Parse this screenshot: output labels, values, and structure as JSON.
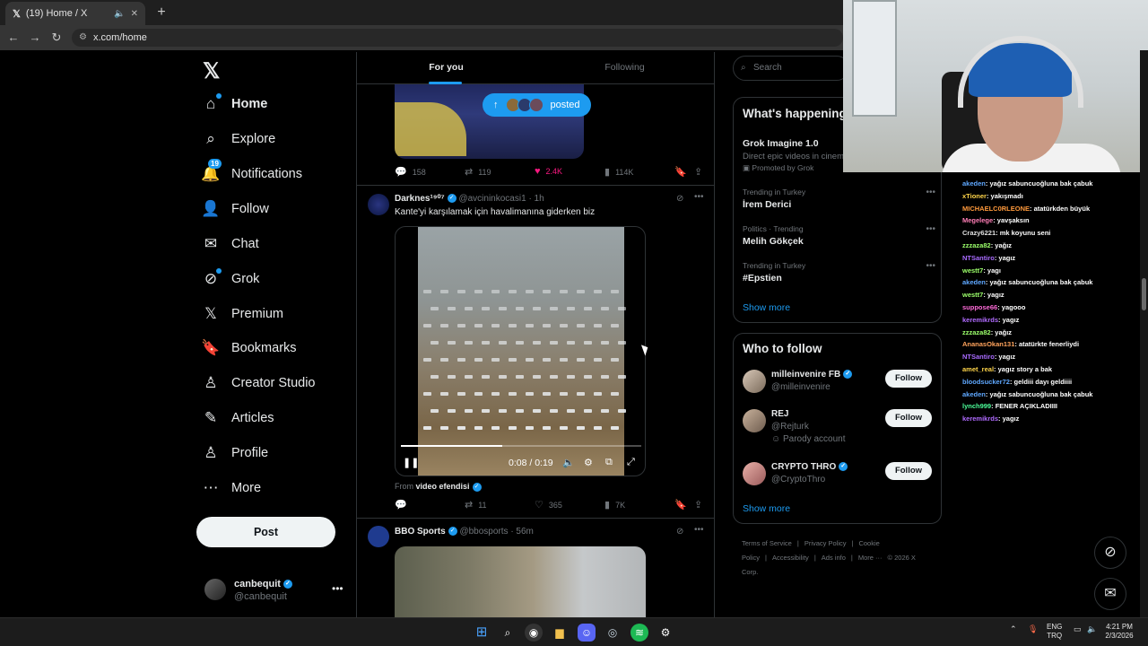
{
  "browser": {
    "tab_title": "(19) Home / X",
    "url": "x.com/home"
  },
  "nav": {
    "items": [
      {
        "label": "Home",
        "icon": "home-icon"
      },
      {
        "label": "Explore",
        "icon": "search-icon"
      },
      {
        "label": "Notifications",
        "icon": "bell-icon",
        "badge": "19"
      },
      {
        "label": "Follow",
        "icon": "person-plus-icon"
      },
      {
        "label": "Chat",
        "icon": "mail-icon"
      },
      {
        "label": "Grok",
        "icon": "grok-icon"
      },
      {
        "label": "Premium",
        "icon": "x-icon"
      },
      {
        "label": "Bookmarks",
        "icon": "bookmark-icon"
      },
      {
        "label": "Creator Studio",
        "icon": "creator-icon"
      },
      {
        "label": "Articles",
        "icon": "article-icon"
      },
      {
        "label": "Profile",
        "icon": "person-icon"
      },
      {
        "label": "More",
        "icon": "more-circle-icon"
      }
    ],
    "post_label": "Post",
    "account": {
      "name": "canbequit",
      "handle": "@canbequit"
    }
  },
  "feed": {
    "tabs": [
      "For you",
      "Following"
    ],
    "posted_label": "posted",
    "top_post": {
      "replies": "158",
      "reposts": "119",
      "likes": "2.4K",
      "views": "114K"
    },
    "darkness_post": {
      "name": "Darknes¹⁹⁰⁷",
      "handle": "@avcininkocasi1",
      "time": "1h",
      "text": "Kante'yi karşılamak için havalimanına giderken biz",
      "video_time": "0:08 / 0:19",
      "video_progress": 0.42,
      "from_label": "From",
      "from_source": "video efendisi",
      "replies": "",
      "reposts": "11",
      "likes": "365",
      "views": "7K"
    },
    "bbo_post": {
      "name": "BBO Sports",
      "handle": "@bbosports",
      "time": "56m"
    }
  },
  "sidebar": {
    "search_placeholder": "Search",
    "happening_title": "What's happening",
    "trends": [
      {
        "context": "",
        "title": "Grok Imagine 1.0",
        "desc": "Direct epic videos in cinematic quality",
        "promo": "Promoted by Grok"
      },
      {
        "context": "Trending in Turkey",
        "title": "İrem Derici"
      },
      {
        "context": "Politics · Trending",
        "title": "Melih Gökçek"
      },
      {
        "context": "Trending in Turkey",
        "title": "#Epstien"
      }
    ],
    "show_more": "Show more",
    "who_title": "Who to follow",
    "who": [
      {
        "name": "milleinvenire FB",
        "handle": "@milleinvenire",
        "extra": "",
        "button": "Follow",
        "verified": true
      },
      {
        "name": "REJ",
        "handle": "@Rejturk",
        "extra": "Parody account",
        "button": "Follow",
        "verified": false
      },
      {
        "name": "CRYPTO THRO",
        "handle": "@CryptoThro",
        "extra": "",
        "button": "Follow",
        "verified": true
      }
    ],
    "who_show_more": "Show more",
    "footer": [
      "Terms of Service",
      "|",
      "Privacy Policy",
      "|",
      "Cookie Policy",
      "|",
      "Accessibility",
      "|",
      "Ads info",
      "|",
      "More ···",
      "© 2026 X Corp."
    ]
  },
  "chat": {
    "lines": [
      {
        "user": "akeden",
        "color": "#5fa8ff",
        "msg": ": yağız sabuncuoğluna bak çabuk"
      },
      {
        "user": "xTioner",
        "color": "#ffd54a",
        "msg": ": yakışmadı"
      },
      {
        "user": "MICHAELC0RLEONE",
        "color": "#ff9a3c",
        "msg": ": atatürkden büyük"
      },
      {
        "user": "Megelege",
        "color": "#ff7eb6",
        "msg": ": yavşaksın"
      },
      {
        "user": "Crazy6221",
        "color": "#e0e0e0",
        "msg": ": mk koyunu seni"
      },
      {
        "user": "zzzaza82",
        "color": "#9cff6b",
        "msg": ": yağız"
      },
      {
        "user": "NTSantiro",
        "color": "#a96bff",
        "msg": ": yagız"
      },
      {
        "user": "westt7",
        "color": "#9cff6b",
        "msg": ": yagı"
      },
      {
        "user": "akeden",
        "color": "#5fa8ff",
        "msg": ": yağız sabuncuoğluna bak çabuk"
      },
      {
        "user": "westt7",
        "color": "#9cff6b",
        "msg": ": yagız"
      },
      {
        "user": "suppose66",
        "color": "#ff6bd9",
        "msg": ": yagooo"
      },
      {
        "user": "keremikrds",
        "color": "#b06bff",
        "msg": ": yagız"
      },
      {
        "user": "zzzaza82",
        "color": "#9cff6b",
        "msg": ": yağız"
      },
      {
        "user": "AnanasOkan131",
        "color": "#ffa35c",
        "msg": ": atatürkte fenerliydi"
      },
      {
        "user": "NTSantiro",
        "color": "#a96bff",
        "msg": ": yagız"
      },
      {
        "user": "amet_real",
        "color": "#ffd54a",
        "msg": ": yagız story a bak"
      },
      {
        "user": "bloodsucker72",
        "color": "#5fa8ff",
        "msg": ": geldiii dayı geldiiii"
      },
      {
        "user": "akeden",
        "color": "#5fa8ff",
        "msg": ": yağız sabuncuoğluna bak çabuk"
      },
      {
        "user": "lynch999",
        "color": "#4cff9a",
        "msg": ": FENER AÇIKLADIIII"
      },
      {
        "user": "keremikrds",
        "color": "#b06bff",
        "msg": ": yagız"
      }
    ]
  },
  "taskbar": {
    "lang1": "ENG",
    "lang2": "TRQ",
    "time": "4:21 PM",
    "date": "2/3/2026"
  }
}
